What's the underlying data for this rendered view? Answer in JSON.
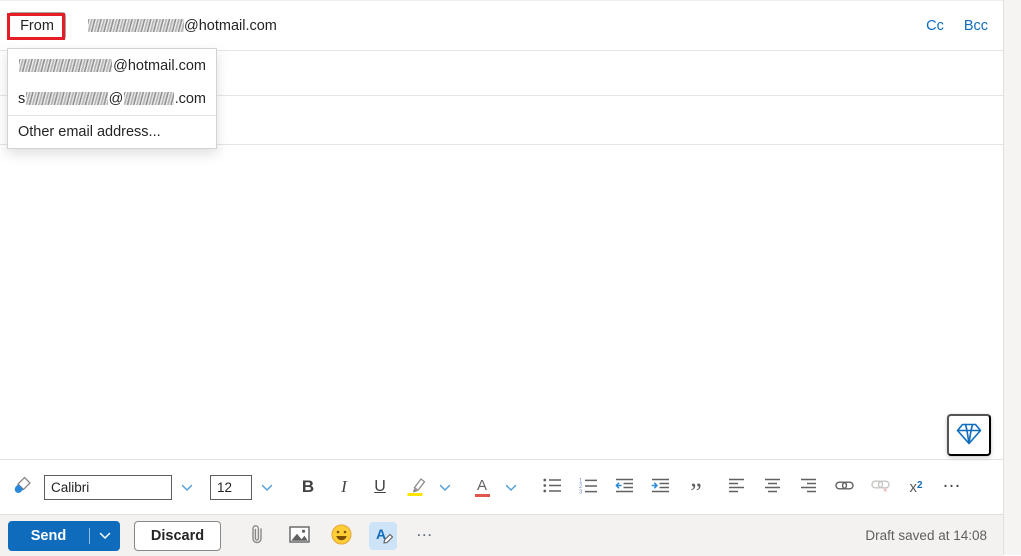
{
  "colors": {
    "accent": "#0f6cbd",
    "annotation_red": "#e71d26",
    "highlight_yellow": "#ffe600",
    "font_color_bar": "#e0564b",
    "selected_tool_bg": "#cde3f7",
    "action_bar_bg": "#f3f2f1"
  },
  "header": {
    "from_button": "From",
    "from_address_masked": true,
    "from_address_suffix": "@hotmail.com",
    "cc": "Cc",
    "bcc": "Bcc"
  },
  "from_dropdown": {
    "option1_suffix": "@hotmail.com",
    "option2_lead": "s",
    "option2_at": "@",
    "option2_tld": ".com",
    "other": "Other email address..."
  },
  "format_toolbar": {
    "font_name": "Calibri",
    "font_size": "12",
    "bold": "B",
    "italic": "I",
    "underline": "U",
    "font_color_letter": "A",
    "quote_glyph": "”",
    "superscript_base": "x",
    "superscript_exp": "2",
    "more_glyph": "…"
  },
  "action_bar": {
    "send": "Send",
    "discard": "Discard",
    "more_glyph": "…",
    "draft_status": "Draft saved at 14:08"
  },
  "icons": {
    "numbered_digits": [
      "1",
      "2",
      "3"
    ],
    "unlink_x": "×",
    "names": [
      "format-painter-icon",
      "chevron-down-icon",
      "highlighter-icon",
      "font-color-icon",
      "bullet-list-icon",
      "numbered-list-icon",
      "outdent-icon",
      "indent-icon",
      "quote-icon",
      "align-left-icon",
      "align-center-icon",
      "align-right-icon",
      "link-icon",
      "unlink-icon",
      "superscript-icon",
      "more-icon",
      "paperclip-icon",
      "image-icon",
      "emoji-icon",
      "ink-editor-icon",
      "diamond-icon"
    ]
  }
}
